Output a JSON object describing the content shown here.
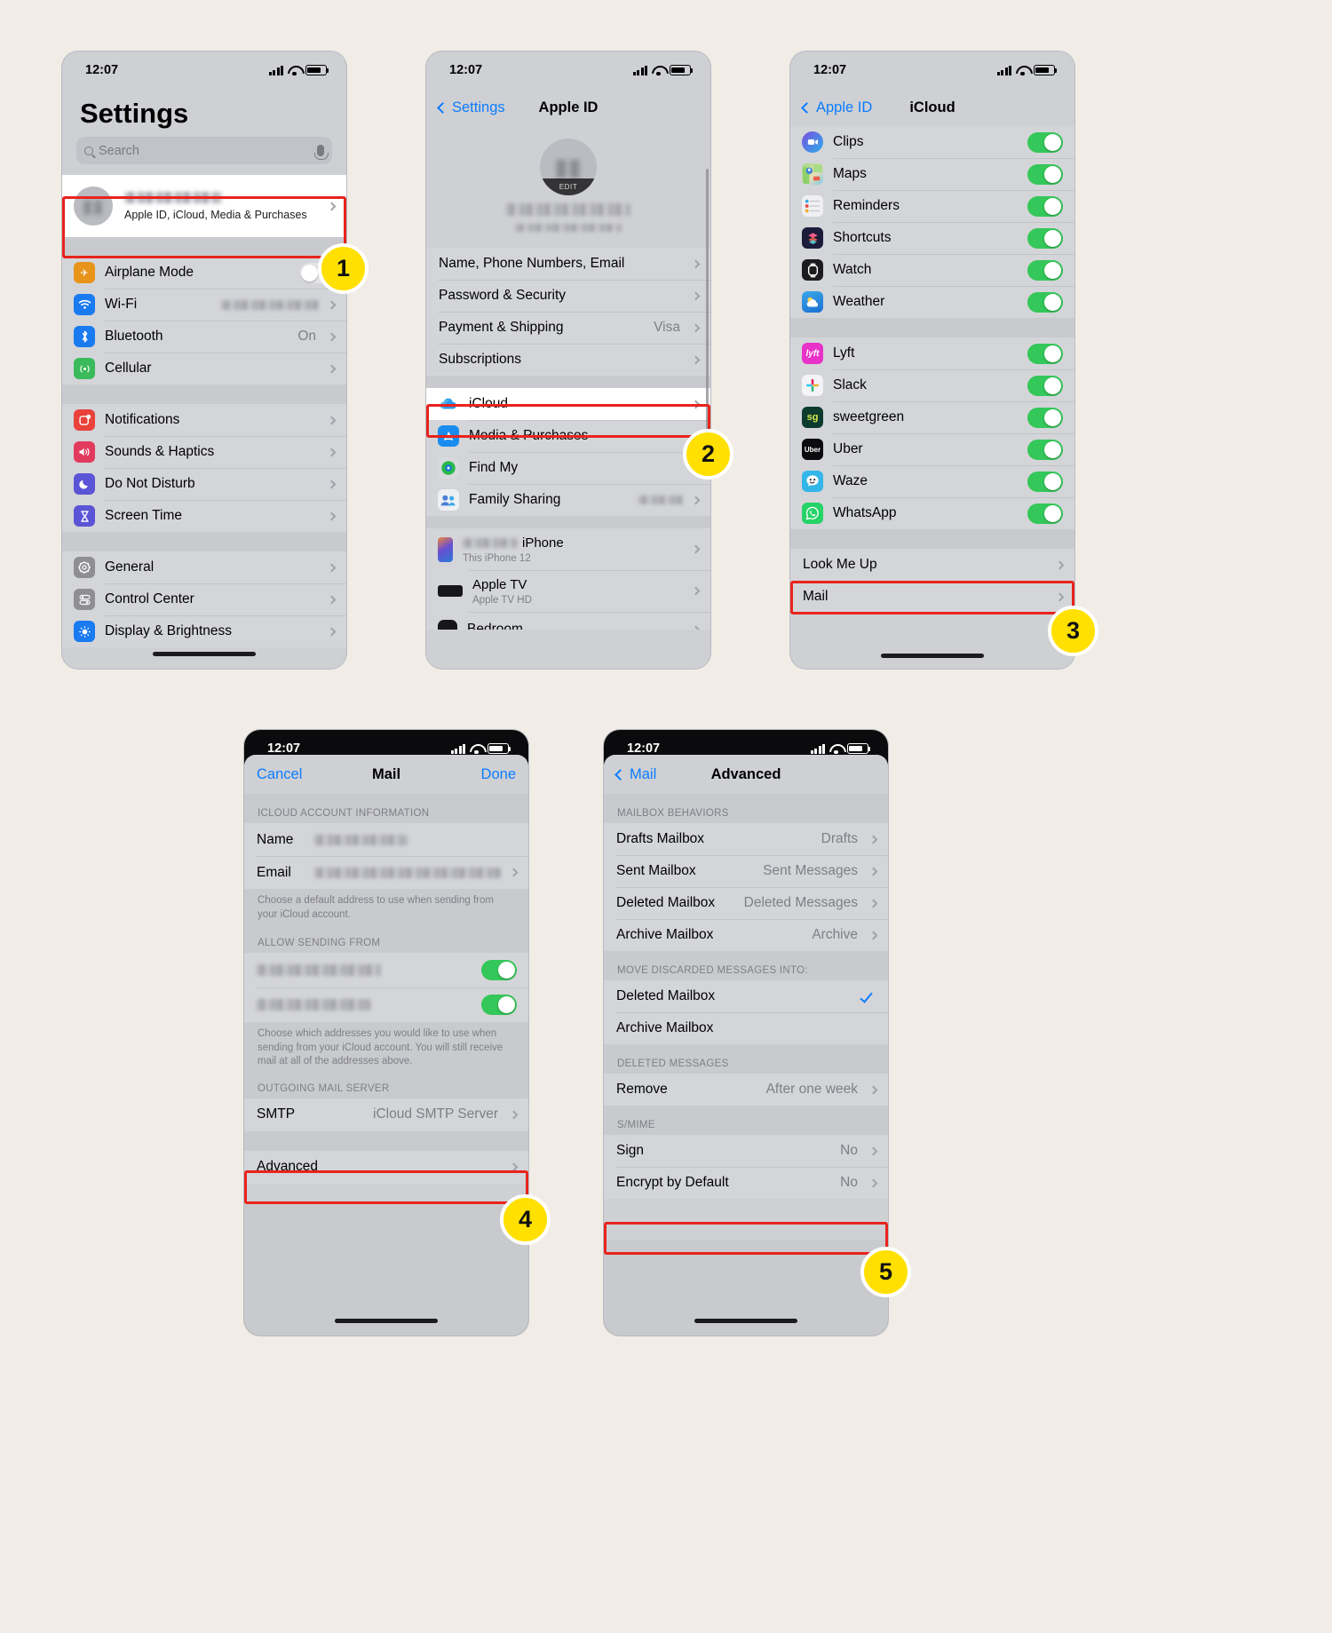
{
  "status": {
    "time": "12:07"
  },
  "phone1": {
    "title": "Settings",
    "search_placeholder": "Search",
    "account": {
      "subtitle": "Apple ID, iCloud, Media & Purchases",
      "name_redacted": true
    },
    "rows": [
      {
        "label": "Airplane Mode",
        "icon": "airplane-icon",
        "color": "#e8941a",
        "type": "toggle",
        "on": false
      },
      {
        "label": "Wi-Fi",
        "icon": "wifi-icon",
        "color": "#1a7af0",
        "type": "chevron",
        "value_redacted": true
      },
      {
        "label": "Bluetooth",
        "icon": "bluetooth-icon",
        "color": "#1a7af0",
        "type": "chevron",
        "value": "On"
      },
      {
        "label": "Cellular",
        "icon": "cellular-icon",
        "color": "#3aba5a",
        "type": "chevron",
        "value": ""
      }
    ],
    "rows2": [
      {
        "label": "Notifications",
        "icon": "notifications-icon",
        "color": "#e8423a",
        "type": "chevron"
      },
      {
        "label": "Sounds & Haptics",
        "icon": "sounds-icon",
        "color": "#e23a5c",
        "type": "chevron"
      },
      {
        "label": "Do Not Disturb",
        "icon": "moon-icon",
        "color": "#5a54d6",
        "type": "chevron"
      },
      {
        "label": "Screen Time",
        "icon": "hourglass-icon",
        "color": "#5a54d6",
        "type": "chevron"
      }
    ],
    "rows3": [
      {
        "label": "General",
        "icon": "gear-icon",
        "color": "#8e8e93",
        "type": "chevron"
      },
      {
        "label": "Control Center",
        "icon": "control-center-icon",
        "color": "#8e8e93",
        "type": "chevron"
      },
      {
        "label": "Display & Brightness",
        "icon": "display-icon",
        "color": "#1a7af0",
        "type": "chevron"
      }
    ]
  },
  "phone2": {
    "back": "Settings",
    "title": "Apple ID",
    "avatar_edit": "EDIT",
    "rows": [
      {
        "label": "Name, Phone Numbers, Email",
        "value": ""
      },
      {
        "label": "Password & Security",
        "value": ""
      },
      {
        "label": "Payment & Shipping",
        "value": "Visa"
      },
      {
        "label": "Subscriptions",
        "value": ""
      }
    ],
    "rows2": [
      {
        "label": "iCloud",
        "icon": "icloud-icon"
      },
      {
        "label": "Media & Purchases",
        "icon": "appstore-icon"
      },
      {
        "label": "Find My",
        "icon": "findmy-icon"
      },
      {
        "label": "Family Sharing",
        "icon": "family-sharing-icon",
        "value_redacted": true
      }
    ],
    "devices": [
      {
        "label": "iPhone",
        "label_redacted": true,
        "sub": "This iPhone 12",
        "icon": "iphone-icon"
      },
      {
        "label": "Apple TV",
        "sub": "Apple TV HD",
        "icon": "appletv-icon"
      },
      {
        "label": "Bedroom",
        "sub": "",
        "icon": "homepod-icon"
      }
    ]
  },
  "phone3": {
    "back": "Apple ID",
    "title": "iCloud",
    "apps": [
      {
        "label": "Clips",
        "icon": "clips-icon",
        "on": true
      },
      {
        "label": "Maps",
        "icon": "maps-icon",
        "on": true
      },
      {
        "label": "Reminders",
        "icon": "reminders-icon",
        "on": true
      },
      {
        "label": "Shortcuts",
        "icon": "shortcuts-icon",
        "on": true
      },
      {
        "label": "Watch",
        "icon": "watch-icon",
        "on": true
      },
      {
        "label": "Weather",
        "icon": "weather-icon",
        "on": true
      }
    ],
    "third_party": [
      {
        "label": "Lyft",
        "icon": "lyft-icon",
        "on": true
      },
      {
        "label": "Slack",
        "icon": "slack-icon",
        "on": true
      },
      {
        "label": "sweetgreen",
        "icon": "sweetgreen-icon",
        "on": true
      },
      {
        "label": "Uber",
        "icon": "uber-icon",
        "on": true
      },
      {
        "label": "Waze",
        "icon": "waze-icon",
        "on": true
      },
      {
        "label": "WhatsApp",
        "icon": "whatsapp-icon",
        "on": true
      }
    ],
    "footer_rows": [
      {
        "label": "Look Me Up"
      },
      {
        "label": "Mail"
      }
    ]
  },
  "phone4": {
    "cancel": "Cancel",
    "title": "Mail",
    "done": "Done",
    "section1_header": "ICLOUD ACCOUNT INFORMATION",
    "name_label": "Name",
    "email_label": "Email",
    "section1_footer": "Choose a default address to use when sending from your iCloud account.",
    "section2_header": "ALLOW SENDING FROM",
    "section2_footer": "Choose which addresses you would like to use when sending from your iCloud account. You will still receive mail at all of the addresses above.",
    "section3_header": "OUTGOING MAIL SERVER",
    "smtp_label": "SMTP",
    "smtp_value": "iCloud SMTP Server",
    "advanced_label": "Advanced"
  },
  "phone5": {
    "back": "Mail",
    "title": "Advanced",
    "section1_header": "MAILBOX BEHAVIORS",
    "mailbox_rows": [
      {
        "label": "Drafts Mailbox",
        "value": "Drafts"
      },
      {
        "label": "Sent Mailbox",
        "value": "Sent Messages"
      },
      {
        "label": "Deleted Mailbox",
        "value": "Deleted Messages"
      },
      {
        "label": "Archive Mailbox",
        "value": "Archive"
      }
    ],
    "section2_header": "MOVE DISCARDED MESSAGES INTO:",
    "discard_rows": [
      {
        "label": "Deleted Mailbox",
        "checked": true
      },
      {
        "label": "Archive Mailbox",
        "checked": false
      }
    ],
    "section3_header": "DELETED MESSAGES",
    "remove_label": "Remove",
    "remove_value": "After one week",
    "section4_header": "S/MIME",
    "smime_rows": [
      {
        "label": "Sign",
        "value": "No"
      },
      {
        "label": "Encrypt by Default",
        "value": "No"
      }
    ]
  },
  "callouts": {
    "one": "1",
    "two": "2",
    "three": "3",
    "four": "4",
    "five": "5"
  },
  "colors": {
    "highlight": "#e8241d",
    "badge": "#ffe000",
    "accent": "#0a7cff",
    "toggle_on": "#34c759",
    "page_bg": "#f1ede6"
  }
}
